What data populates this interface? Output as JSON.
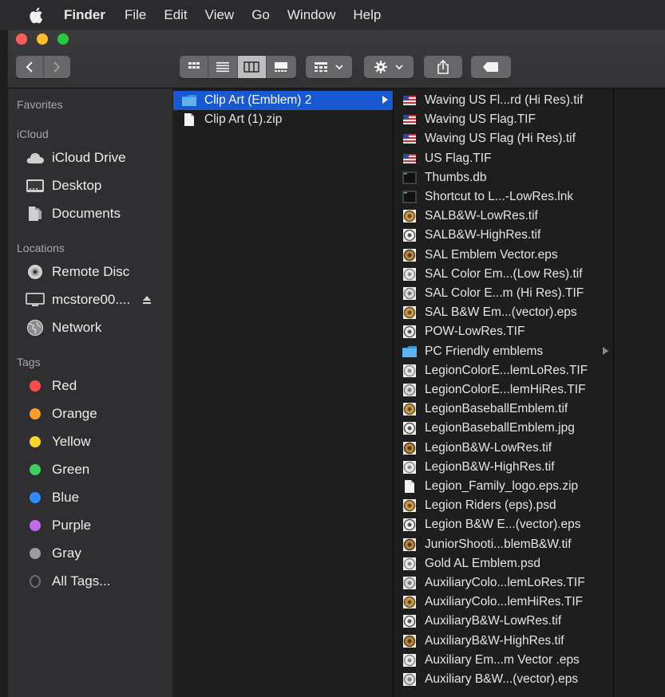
{
  "menubar": {
    "items": [
      "Finder",
      "File",
      "Edit",
      "View",
      "Go",
      "Window",
      "Help"
    ]
  },
  "sidebar": {
    "favorites_header": "Favorites",
    "icloud_header": "iCloud",
    "icloud_items": [
      "iCloud Drive",
      "Desktop",
      "Documents"
    ],
    "locations_header": "Locations",
    "location_items": [
      "Remote Disc",
      "mcstore00....",
      "Network"
    ],
    "tags_header": "Tags",
    "tags": [
      {
        "label": "Red",
        "color": "#fe4c4c"
      },
      {
        "label": "Orange",
        "color": "#fe9a2e"
      },
      {
        "label": "Yellow",
        "color": "#f7d62b"
      },
      {
        "label": "Green",
        "color": "#3fd05a"
      },
      {
        "label": "Blue",
        "color": "#2e8cff"
      },
      {
        "label": "Purple",
        "color": "#c16be8"
      },
      {
        "label": "Gray",
        "color": "#9c9c9e"
      },
      {
        "label": "All Tags...",
        "color": "#6e6e70"
      }
    ]
  },
  "column1": {
    "items": [
      {
        "label": "Clip Art (Emblem) 2",
        "icon": "folder-icon",
        "selected": true
      },
      {
        "label": "Clip Art (1).zip",
        "icon": "document-icon",
        "selected": false
      }
    ]
  },
  "column2": {
    "items": [
      {
        "label": "Waving US Fl...rd (Hi Res).tif",
        "icon": "flag-thumb-icon"
      },
      {
        "label": "Waving US Flag.TIF",
        "icon": "flag-thumb-icon"
      },
      {
        "label": "Waving US Flag (Hi Res).tif",
        "icon": "flag-thumb-icon"
      },
      {
        "label": "US Flag.TIF",
        "icon": "flag-thumb-icon"
      },
      {
        "label": "Thumbs.db",
        "icon": "terminal-file-icon"
      },
      {
        "label": "Shortcut to L...-LowRes.lnk",
        "icon": "terminal-file-icon"
      },
      {
        "label": "SALB&W-LowRes.tif",
        "icon": "emblem-thumb-icon"
      },
      {
        "label": "SALB&W-HighRes.tif",
        "icon": "emblem-thumb-icon"
      },
      {
        "label": "SAL Emblem Vector.eps",
        "icon": "emblem-thumb-icon"
      },
      {
        "label": "SAL Color Em...(Low Res).tif",
        "icon": "emblem-thumb-icon"
      },
      {
        "label": "SAL Color E...m (Hi Res).TIF",
        "icon": "emblem-thumb-icon"
      },
      {
        "label": "SAL B&W Em...(vector).eps",
        "icon": "emblem-thumb-icon"
      },
      {
        "label": "POW-LowRes.TIF",
        "icon": "emblem-thumb-icon"
      },
      {
        "label": "PC Friendly emblems",
        "icon": "folder-icon"
      },
      {
        "label": "LegionColorE...lemLoRes.TIF",
        "icon": "emblem-thumb-icon"
      },
      {
        "label": "LegionColorE...lemHiRes.TIF",
        "icon": "emblem-thumb-icon"
      },
      {
        "label": "LegionBaseballEmblem.tif",
        "icon": "emblem-thumb-icon"
      },
      {
        "label": "LegionBaseballEmblem.jpg",
        "icon": "emblem-thumb-icon"
      },
      {
        "label": "LegionB&W-LowRes.tif",
        "icon": "emblem-thumb-icon"
      },
      {
        "label": "LegionB&W-HighRes.tif",
        "icon": "emblem-thumb-icon"
      },
      {
        "label": "Legion_Family_logo.eps.zip",
        "icon": "document-icon"
      },
      {
        "label": "Legion Riders (eps).psd",
        "icon": "emblem-thumb-icon"
      },
      {
        "label": "Legion B&W E...(vector).eps",
        "icon": "emblem-thumb-icon"
      },
      {
        "label": "JuniorShooti...blemB&W.tif",
        "icon": "emblem-thumb-icon"
      },
      {
        "label": "Gold AL Emblem.psd",
        "icon": "emblem-thumb-icon"
      },
      {
        "label": "AuxiliaryColo...lemLoRes.TIF",
        "icon": "emblem-thumb-icon"
      },
      {
        "label": "AuxiliaryColo...lemHiRes.TIF",
        "icon": "emblem-thumb-icon"
      },
      {
        "label": "AuxiliaryB&W-LowRes.tif",
        "icon": "emblem-thumb-icon"
      },
      {
        "label": "AuxiliaryB&W-HighRes.tif",
        "icon": "emblem-thumb-icon"
      },
      {
        "label": "Auxiliary Em...m Vector .eps",
        "icon": "emblem-thumb-icon"
      },
      {
        "label": "Auxiliary B&W...(vector).eps",
        "icon": "emblem-thumb-icon"
      }
    ]
  }
}
